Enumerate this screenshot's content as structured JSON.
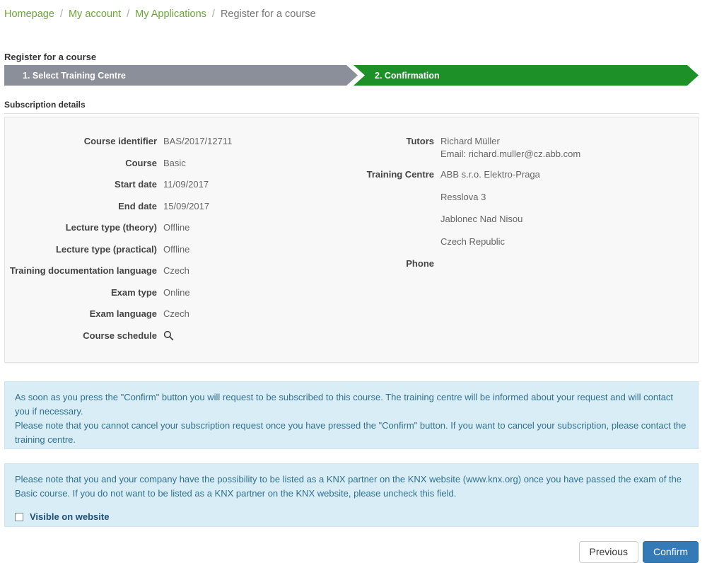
{
  "breadcrumb": {
    "separator": "/",
    "items": [
      {
        "label": "Homepage",
        "current": false
      },
      {
        "label": "My account",
        "current": false
      },
      {
        "label": "My Applications",
        "current": false
      },
      {
        "label": "Register for a course",
        "current": true
      }
    ]
  },
  "page": {
    "title": "Register for a course"
  },
  "wizard": {
    "steps": [
      {
        "label": "1. Select Training Centre",
        "state": "completed",
        "color": "#8b8f99"
      },
      {
        "label": "2. Confirmation",
        "state": "active",
        "color": "#1d9127"
      }
    ]
  },
  "section": {
    "heading": "Subscription details"
  },
  "details": {
    "left": [
      {
        "label": "Course identifier",
        "value": "BAS/2017/12711"
      },
      {
        "label": "Course",
        "value": "Basic"
      },
      {
        "label": "Start date",
        "value": "11/09/2017"
      },
      {
        "label": "End date",
        "value": "15/09/2017"
      },
      {
        "label": "Lecture type (theory)",
        "value": "Offline"
      },
      {
        "label": "Lecture type (practical)",
        "value": "Offline"
      },
      {
        "label": "Training documentation language",
        "value": "Czech"
      },
      {
        "label": "Exam type",
        "value": "Online"
      },
      {
        "label": "Exam language",
        "value": "Czech"
      },
      {
        "label": "Course schedule",
        "value": "",
        "icon": "search-icon"
      }
    ],
    "right": {
      "tutors_label": "Tutors",
      "tutor_name": "Richard Müller",
      "tutor_email": "Email: richard.muller@cz.abb.com",
      "training_centre_label": "Training Centre",
      "training_centre_name": "ABB s.r.o. Elektro-Praga",
      "training_centre_street": "Resslova 3",
      "training_centre_city": "Jablonec Nad Nisou",
      "training_centre_country": "Czech Republic",
      "phone_label": "Phone",
      "phone_value": ""
    }
  },
  "alerts": {
    "confirm_note_line1": "As soon as you press the \"Confirm\" button you will request to be subscribed to this course. The training centre will be informed about your request and will contact you if necessary.",
    "confirm_note_line2": "Please note that you cannot cancel your subscription request once you have pressed the \"Confirm\" button. If you want to cancel your subscription, please contact the training centre.",
    "knx_partner_note": "Please note that you and your company have the possibility to be listed as a KNX partner on the KNX website (www.knx.org) once you have passed the exam of the Basic course. If you do not want to be listed as a KNX partner on the KNX website, please uncheck this field.",
    "visible_checkbox_label": "Visible on website",
    "visible_checkbox_checked": false
  },
  "footer": {
    "previous_label": "Previous",
    "confirm_label": "Confirm"
  },
  "colors": {
    "link_green": "#6ba539",
    "step_active_green": "#1d9127",
    "step_done_gray": "#8b8f99",
    "alert_bg": "#d9edf7",
    "alert_text": "#31708f",
    "primary_blue": "#337ab7",
    "panel_bg": "#f8f8f8"
  }
}
